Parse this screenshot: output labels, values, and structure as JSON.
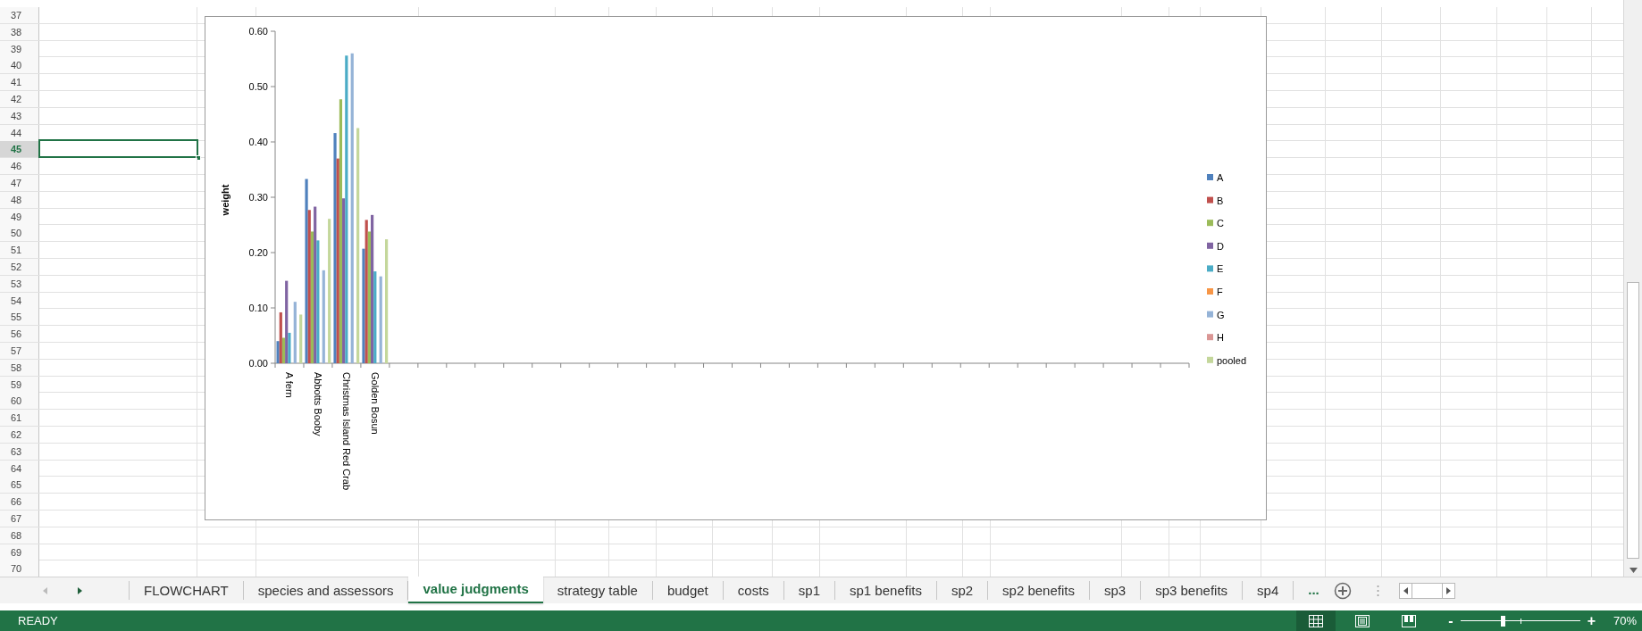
{
  "sheet": {
    "rows": [
      {
        "label": "37",
        "selected": false
      },
      {
        "label": "38",
        "selected": false
      },
      {
        "label": "39",
        "selected": false
      },
      {
        "label": "40",
        "selected": false
      },
      {
        "label": "41",
        "selected": false
      },
      {
        "label": "42",
        "selected": false
      },
      {
        "label": "43",
        "selected": false
      },
      {
        "label": "44",
        "selected": false
      },
      {
        "label": "45",
        "selected": true
      },
      {
        "label": "46",
        "selected": false
      },
      {
        "label": "47",
        "selected": false
      },
      {
        "label": "48",
        "selected": false
      },
      {
        "label": "49",
        "selected": false
      },
      {
        "label": "50",
        "selected": false
      },
      {
        "label": "51",
        "selected": false
      },
      {
        "label": "52",
        "selected": false
      },
      {
        "label": "53",
        "selected": false
      },
      {
        "label": "54",
        "selected": false
      },
      {
        "label": "55",
        "selected": false
      },
      {
        "label": "56",
        "selected": false
      },
      {
        "label": "57",
        "selected": false
      },
      {
        "label": "58",
        "selected": false
      },
      {
        "label": "59",
        "selected": false
      },
      {
        "label": "60",
        "selected": false
      },
      {
        "label": "61",
        "selected": false
      },
      {
        "label": "62",
        "selected": false
      },
      {
        "label": "63",
        "selected": false
      },
      {
        "label": "64",
        "selected": false
      },
      {
        "label": "65",
        "selected": false
      },
      {
        "label": "66",
        "selected": false
      },
      {
        "label": "67",
        "selected": false
      },
      {
        "label": "68",
        "selected": false
      },
      {
        "label": "69",
        "selected": false
      },
      {
        "label": "70",
        "selected": false
      }
    ]
  },
  "chart": {
    "chart_data": {
      "type": "bar",
      "ylabel": "weight",
      "categories": [
        "A fern",
        "Abbotts Booby",
        "Christmas Island Red Crab",
        "Golden Bosun"
      ],
      "series": [
        {
          "name": "A",
          "color": "#4f81bd",
          "values": [
            0.04,
            0.333,
            0.416,
            0.207
          ]
        },
        {
          "name": "B",
          "color": "#c0504d",
          "values": [
            0.092,
            0.277,
            0.37,
            0.259
          ]
        },
        {
          "name": "C",
          "color": "#9bbb59",
          "values": [
            0.046,
            0.238,
            0.477,
            0.238
          ]
        },
        {
          "name": "D",
          "color": "#8064a2",
          "values": [
            0.149,
            0.283,
            0.298,
            0.268
          ]
        },
        {
          "name": "E",
          "color": "#4bacc6",
          "values": [
            0.055,
            0.222,
            0.556,
            0.166
          ]
        },
        {
          "name": "F",
          "color": "#f79646",
          "values": [
            null,
            null,
            null,
            null
          ]
        },
        {
          "name": "G",
          "color": "#95b3d7",
          "values": [
            0.111,
            0.168,
            0.56,
            0.157
          ]
        },
        {
          "name": "H",
          "color": "#da9694",
          "values": [
            null,
            null,
            null,
            null
          ]
        },
        {
          "name": "pooled",
          "color": "#c4d79b",
          "values": [
            0.088,
            0.261,
            0.425,
            0.224
          ]
        }
      ],
      "ylim": [
        0,
        0.6
      ],
      "legend": "right",
      "yticks": [
        {
          "value": 0,
          "label": "0.00"
        },
        {
          "value": 0.1,
          "label": "0.10"
        },
        {
          "value": 0.2,
          "label": "0.20"
        },
        {
          "value": 0.3,
          "label": "0.30"
        },
        {
          "value": 0.4,
          "label": "0.40"
        },
        {
          "value": 0.5,
          "label": "0.50"
        },
        {
          "value": 0.6,
          "label": "0.60"
        }
      ]
    }
  },
  "sheet_tabs": {
    "tabs": [
      {
        "label": "FLOWCHART",
        "selected": false
      },
      {
        "label": "species and assessors",
        "selected": false
      },
      {
        "label": "value judgments",
        "selected": true
      },
      {
        "label": "strategy table",
        "selected": false
      },
      {
        "label": "budget",
        "selected": false
      },
      {
        "label": "costs",
        "selected": false
      },
      {
        "label": "sp1",
        "selected": false
      },
      {
        "label": "sp1 benefits",
        "selected": false
      },
      {
        "label": "sp2",
        "selected": false
      },
      {
        "label": "sp2 benefits",
        "selected": false
      },
      {
        "label": "sp3",
        "selected": false
      },
      {
        "label": "sp3 benefits",
        "selected": false
      },
      {
        "label": "sp4",
        "selected": false
      }
    ],
    "more": "..."
  },
  "status_bar": {
    "status": "READY",
    "views": [
      {
        "kind": "normal",
        "selected": true
      },
      {
        "kind": "page_layout",
        "selected": false
      },
      {
        "kind": "page_break",
        "selected": false
      }
    ],
    "zoom": {
      "minus": "-",
      "plus": "+",
      "level": 0.35,
      "reading": "70%"
    }
  }
}
